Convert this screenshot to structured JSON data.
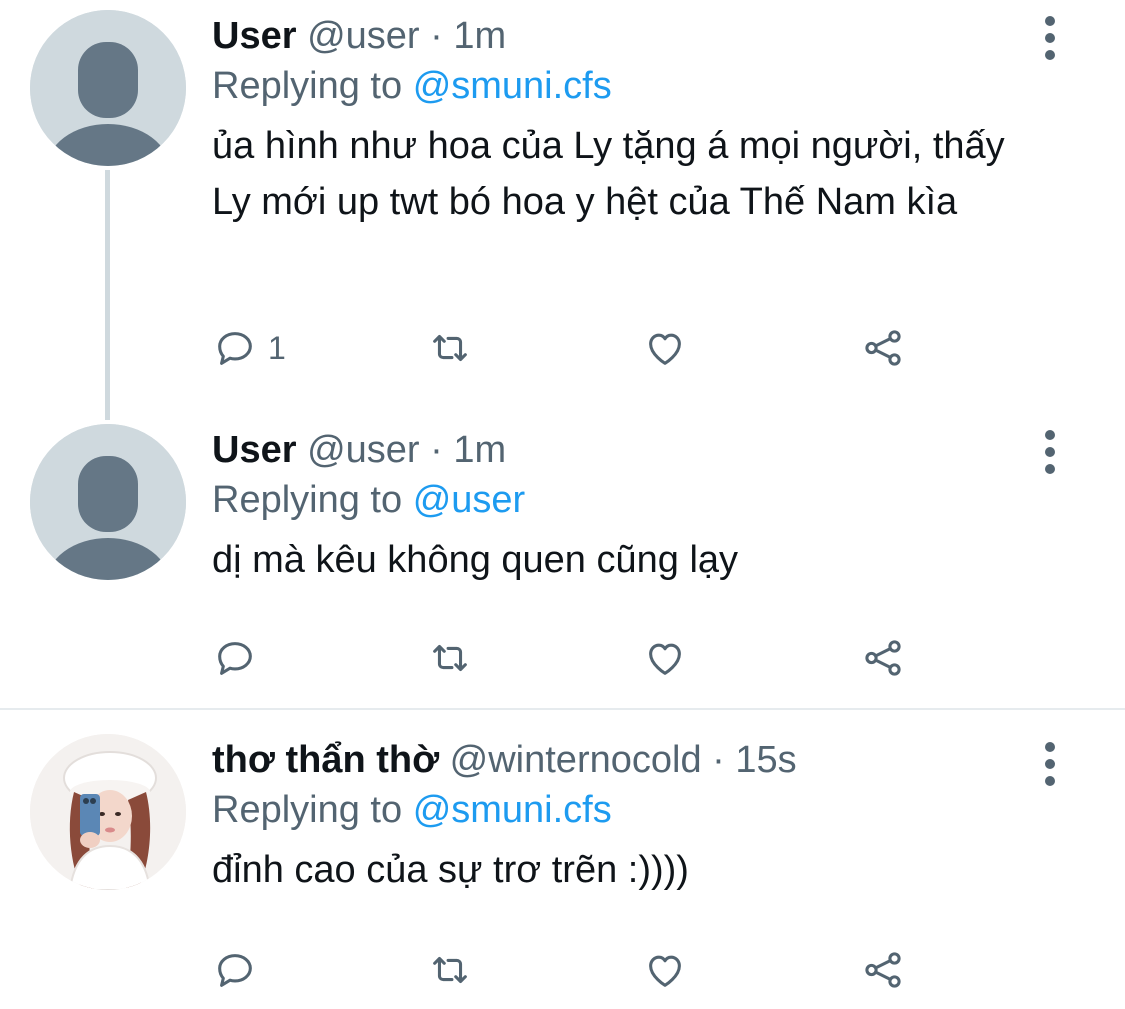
{
  "tweets": [
    {
      "name": "User",
      "handle": "@user",
      "separator": "·",
      "time": "1m",
      "replying_prefix": "Replying to",
      "replying_to": "@smuni.cfs",
      "text": "ủa hình như hoa của Ly tặng á mọi người, thấy Ly mới up twt bó hoa y hệt của Thế Nam kìa",
      "reply_count": "1"
    },
    {
      "name": "User",
      "handle": "@user",
      "separator": "·",
      "time": "1m",
      "replying_prefix": "Replying to",
      "replying_to": "@user",
      "text": "dị mà kêu không quen cũng lạy",
      "reply_count": ""
    },
    {
      "name": "thơ thẩn thờ",
      "handle": "@winternocold",
      "separator": "·",
      "time": "15s",
      "replying_prefix": "Replying to",
      "replying_to": "@smuni.cfs",
      "text": "đỉnh cao của sự trơ trẽn :))))",
      "reply_count": ""
    }
  ],
  "colors": {
    "accent": "#1d9bf0",
    "secondary_text": "#536471",
    "primary_text": "#0f1419",
    "thread_line": "#cfd9de"
  },
  "icons": [
    "more-icon",
    "reply-icon",
    "retweet-icon",
    "like-icon",
    "share-icon",
    "default-avatar-icon"
  ]
}
